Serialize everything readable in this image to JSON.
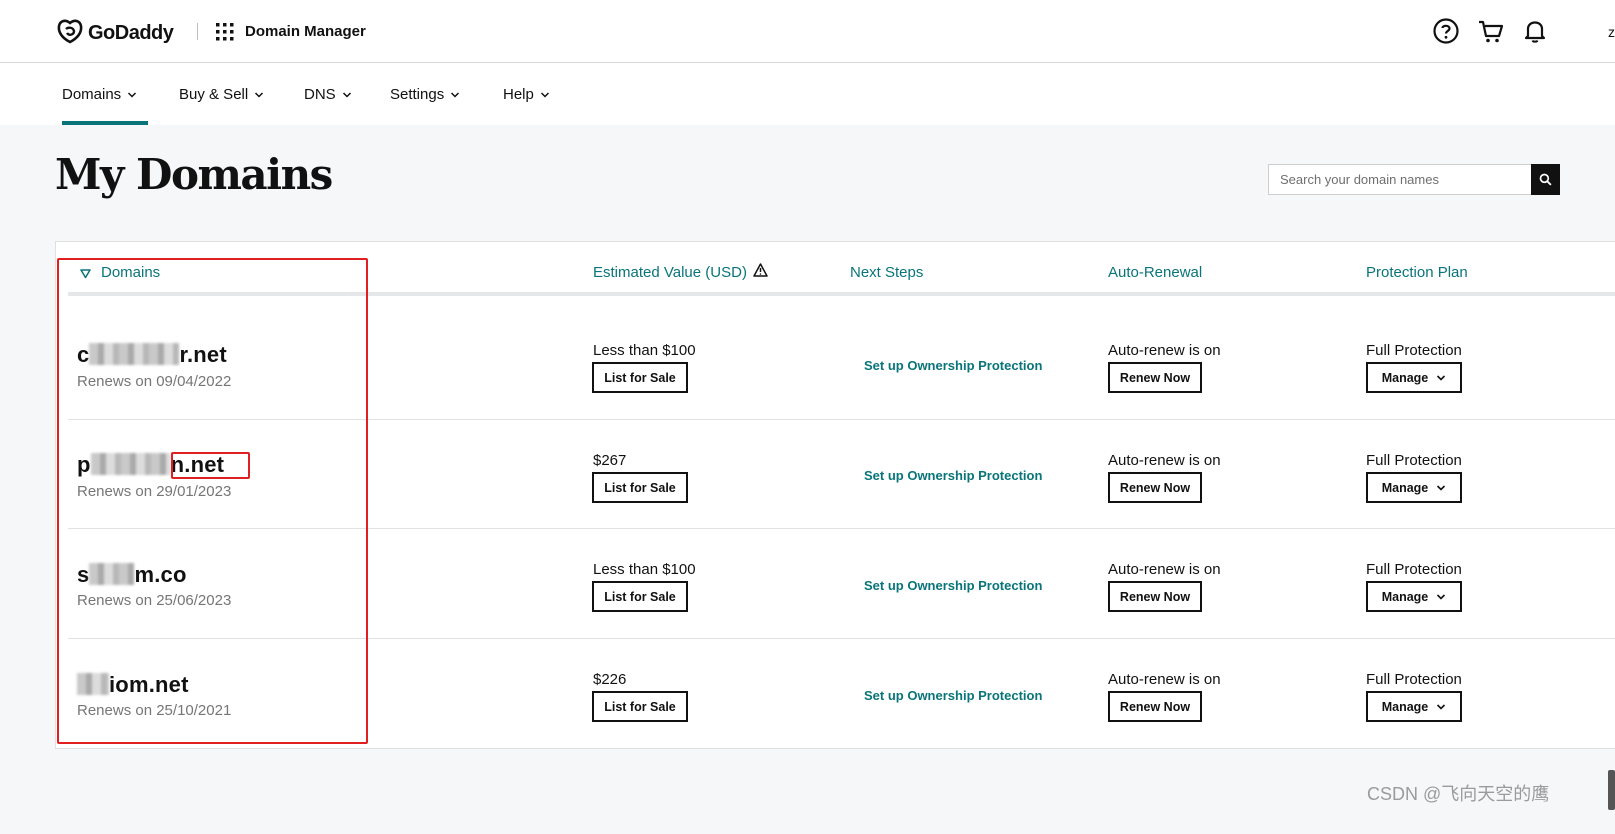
{
  "header": {
    "brand": "GoDaddy",
    "app_title": "Domain Manager",
    "icons": [
      "godaddy-logo-icon",
      "apps-grid-icon",
      "help-icon",
      "cart-icon",
      "bell-icon"
    ],
    "edge_char": "z"
  },
  "nav": {
    "items": [
      {
        "label": "Domains",
        "active": true
      },
      {
        "label": "Buy & Sell"
      },
      {
        "label": "DNS"
      },
      {
        "label": "Settings"
      },
      {
        "label": "Help"
      }
    ]
  },
  "page": {
    "title": "My Domains",
    "search_placeholder": "Search your domain names"
  },
  "table": {
    "columns": {
      "domains": "Domains",
      "estimated_value": "Estimated Value (USD)",
      "next_steps": "Next Steps",
      "auto_renewal": "Auto-Renewal",
      "protection_plan": "Protection Plan"
    },
    "rows": [
      {
        "domain_prefix": "c",
        "domain_suffix": "r.net",
        "renews": "Renews on 09/04/2022",
        "value": "Less than $100",
        "sale_button": "List for Sale",
        "next_step": "Set up Ownership Protection",
        "auto_renew": "Auto-renew is on",
        "renew_button": "Renew Now",
        "protection": "Full Protection",
        "manage_button": "Manage"
      },
      {
        "domain_prefix": "p",
        "domain_suffix": "n.net",
        "renews": "Renews on 29/01/2023",
        "value": "$267",
        "sale_button": "List for Sale",
        "next_step": "Set up Ownership Protection",
        "auto_renew": "Auto-renew is on",
        "renew_button": "Renew Now",
        "protection": "Full Protection",
        "manage_button": "Manage"
      },
      {
        "domain_prefix": "s",
        "domain_suffix": "m.co",
        "renews": "Renews on 25/06/2023",
        "value": "Less than $100",
        "sale_button": "List for Sale",
        "next_step": "Set up Ownership Protection",
        "auto_renew": "Auto-renew is on",
        "renew_button": "Renew Now",
        "protection": "Full Protection",
        "manage_button": "Manage"
      },
      {
        "domain_prefix": "",
        "domain_suffix": "iom.net",
        "renews": "Renews on 25/10/2021",
        "value": "$226",
        "sale_button": "List for Sale",
        "next_step": "Set up Ownership Protection",
        "auto_renew": "Auto-renew is on",
        "renew_button": "Renew Now",
        "protection": "Full Protection",
        "manage_button": "Manage"
      }
    ]
  },
  "watermark": "CSDN @飞向天空的鹰",
  "colors": {
    "accent_teal": "#09757a",
    "annotation_red": "#e02020",
    "page_bg": "#f5f7f8"
  }
}
